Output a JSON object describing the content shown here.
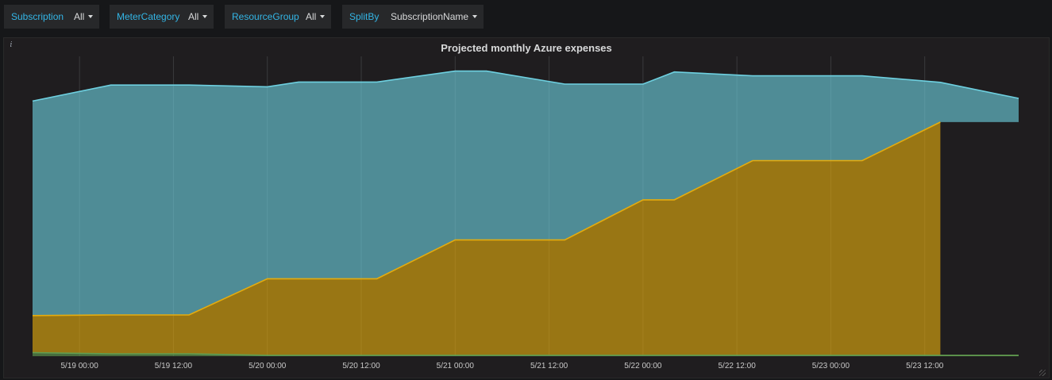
{
  "variables": [
    {
      "label": "Subscription",
      "value": "All"
    },
    {
      "label": "MeterCategory",
      "value": "All"
    },
    {
      "label": "ResourceGroup",
      "value": "All"
    },
    {
      "label": "SplitBy",
      "value": "SubscriptionName"
    }
  ],
  "panel": {
    "title": "Projected monthly Azure expenses",
    "info_glyph": "i"
  },
  "colors": {
    "background": "#161719",
    "panel": "#1f1d1f",
    "label_accent": "#33b5e5",
    "series": [
      "#629e51",
      "#e5ac0e",
      "#6ed0e0"
    ]
  },
  "chart_data": {
    "type": "area",
    "stacked": true,
    "grid": true,
    "legend": "none",
    "x": [
      "5/18 18:00",
      "5/19 04:00",
      "5/19 14:00",
      "5/20 00:00",
      "5/20 04:00",
      "5/20 14:00",
      "5/21 00:00",
      "5/21 04:00",
      "5/21 14:00",
      "5/22 00:00",
      "5/22 04:00",
      "5/22 14:00",
      "5/23 00:00",
      "5/23 04:00",
      "5/23 14:00",
      "5/24 00:00"
    ],
    "x_ticks": [
      "5/19 00:00",
      "5/19 12:00",
      "5/20 00:00",
      "5/20 12:00",
      "5/21 00:00",
      "5/21 12:00",
      "5/22 00:00",
      "5/22 12:00",
      "5/23 00:00",
      "5/23 12:00"
    ],
    "ylim": [
      0,
      100
    ],
    "series": [
      {
        "values": [
          1.2,
          0.8,
          0.8,
          0.3,
          0.3,
          0.3,
          0.3,
          0.3,
          0.3,
          0.3,
          0.3,
          0.3,
          0.3,
          0.3,
          0.3,
          0.3
        ]
      },
      {
        "values": [
          13.7,
          13.9,
          13.9,
          26.1,
          26.1,
          26.1,
          39.2,
          39.2,
          39.2,
          52.7,
          52.7,
          65.9,
          65.9,
          65.9,
          78.9
        ]
      },
      {
        "values": [
          86.0,
          91.4,
          91.4,
          90.8,
          92.4,
          92.4,
          96.1,
          96.1,
          91.7,
          91.7,
          95.8,
          94.5,
          94.5,
          94.5,
          92.3,
          86.9
        ]
      }
    ]
  }
}
